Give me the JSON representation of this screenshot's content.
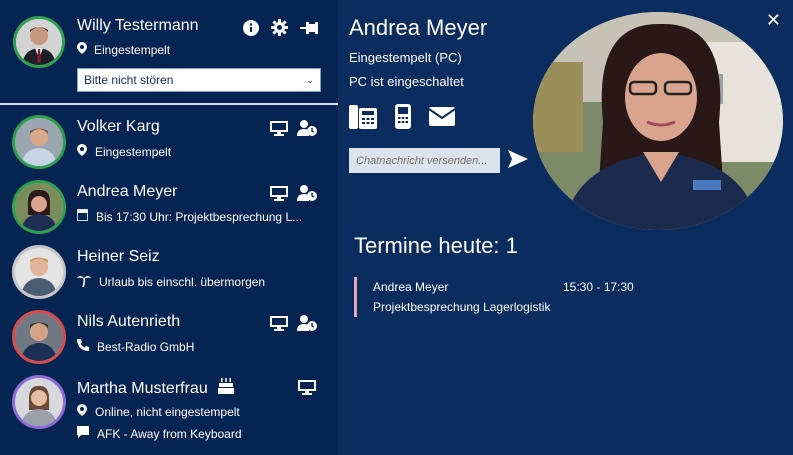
{
  "me": {
    "name": "Willy Testermann",
    "status": "Eingestempelt",
    "dnd_value": "Bitte nicht stören"
  },
  "contacts": [
    {
      "name": "Volker Karg",
      "status": "Eingestempelt",
      "ring": "#2e9e4f"
    },
    {
      "name": "Andrea Meyer",
      "status": "Bis 17:30 Uhr: Projektbesprechung L...",
      "ring": "#2e9e4f"
    },
    {
      "name": "Heiner Seiz",
      "status": "Urlaub bis einschl. übermorgen",
      "ring": "#c7c7c7"
    },
    {
      "name": "Nils Autenrieth",
      "status": "Best-Radio GmbH",
      "ring": "#d94b4b"
    },
    {
      "name": "Martha Musterfrau",
      "status": "Online, nicht eingestempelt",
      "status2": "AFK - Away from Keyboard",
      "ring": "#8a6bd6"
    }
  ],
  "detail": {
    "name": "Andrea Meyer",
    "line1": "Eingestempelt (PC)",
    "line2": "PC ist eingeschaltet",
    "chat_placeholder": "Chatnachricht versenden...",
    "termine_title": "Termine heute: 1",
    "appointments": [
      {
        "who": "Andrea Meyer",
        "time": "15:30 - 17:30",
        "title": "Projektbesprechung Lagerlogistik"
      }
    ]
  },
  "colors": {
    "left_bg": "#052452",
    "right_bg": "#0a2c5e",
    "online": "#2e9e4f",
    "busy": "#d94b4b",
    "away": "#8a6bd6",
    "appt_bar": "#e2a8b3"
  },
  "icons": [
    "info-icon",
    "gear-icon",
    "pin-icon",
    "location-icon",
    "monitor-icon",
    "user-clock-icon",
    "calendar-icon",
    "palm-icon",
    "phone-icon",
    "cake-icon",
    "chat-icon",
    "desk-phone-icon",
    "mobile-icon",
    "mail-icon",
    "send-icon",
    "close-icon"
  ]
}
